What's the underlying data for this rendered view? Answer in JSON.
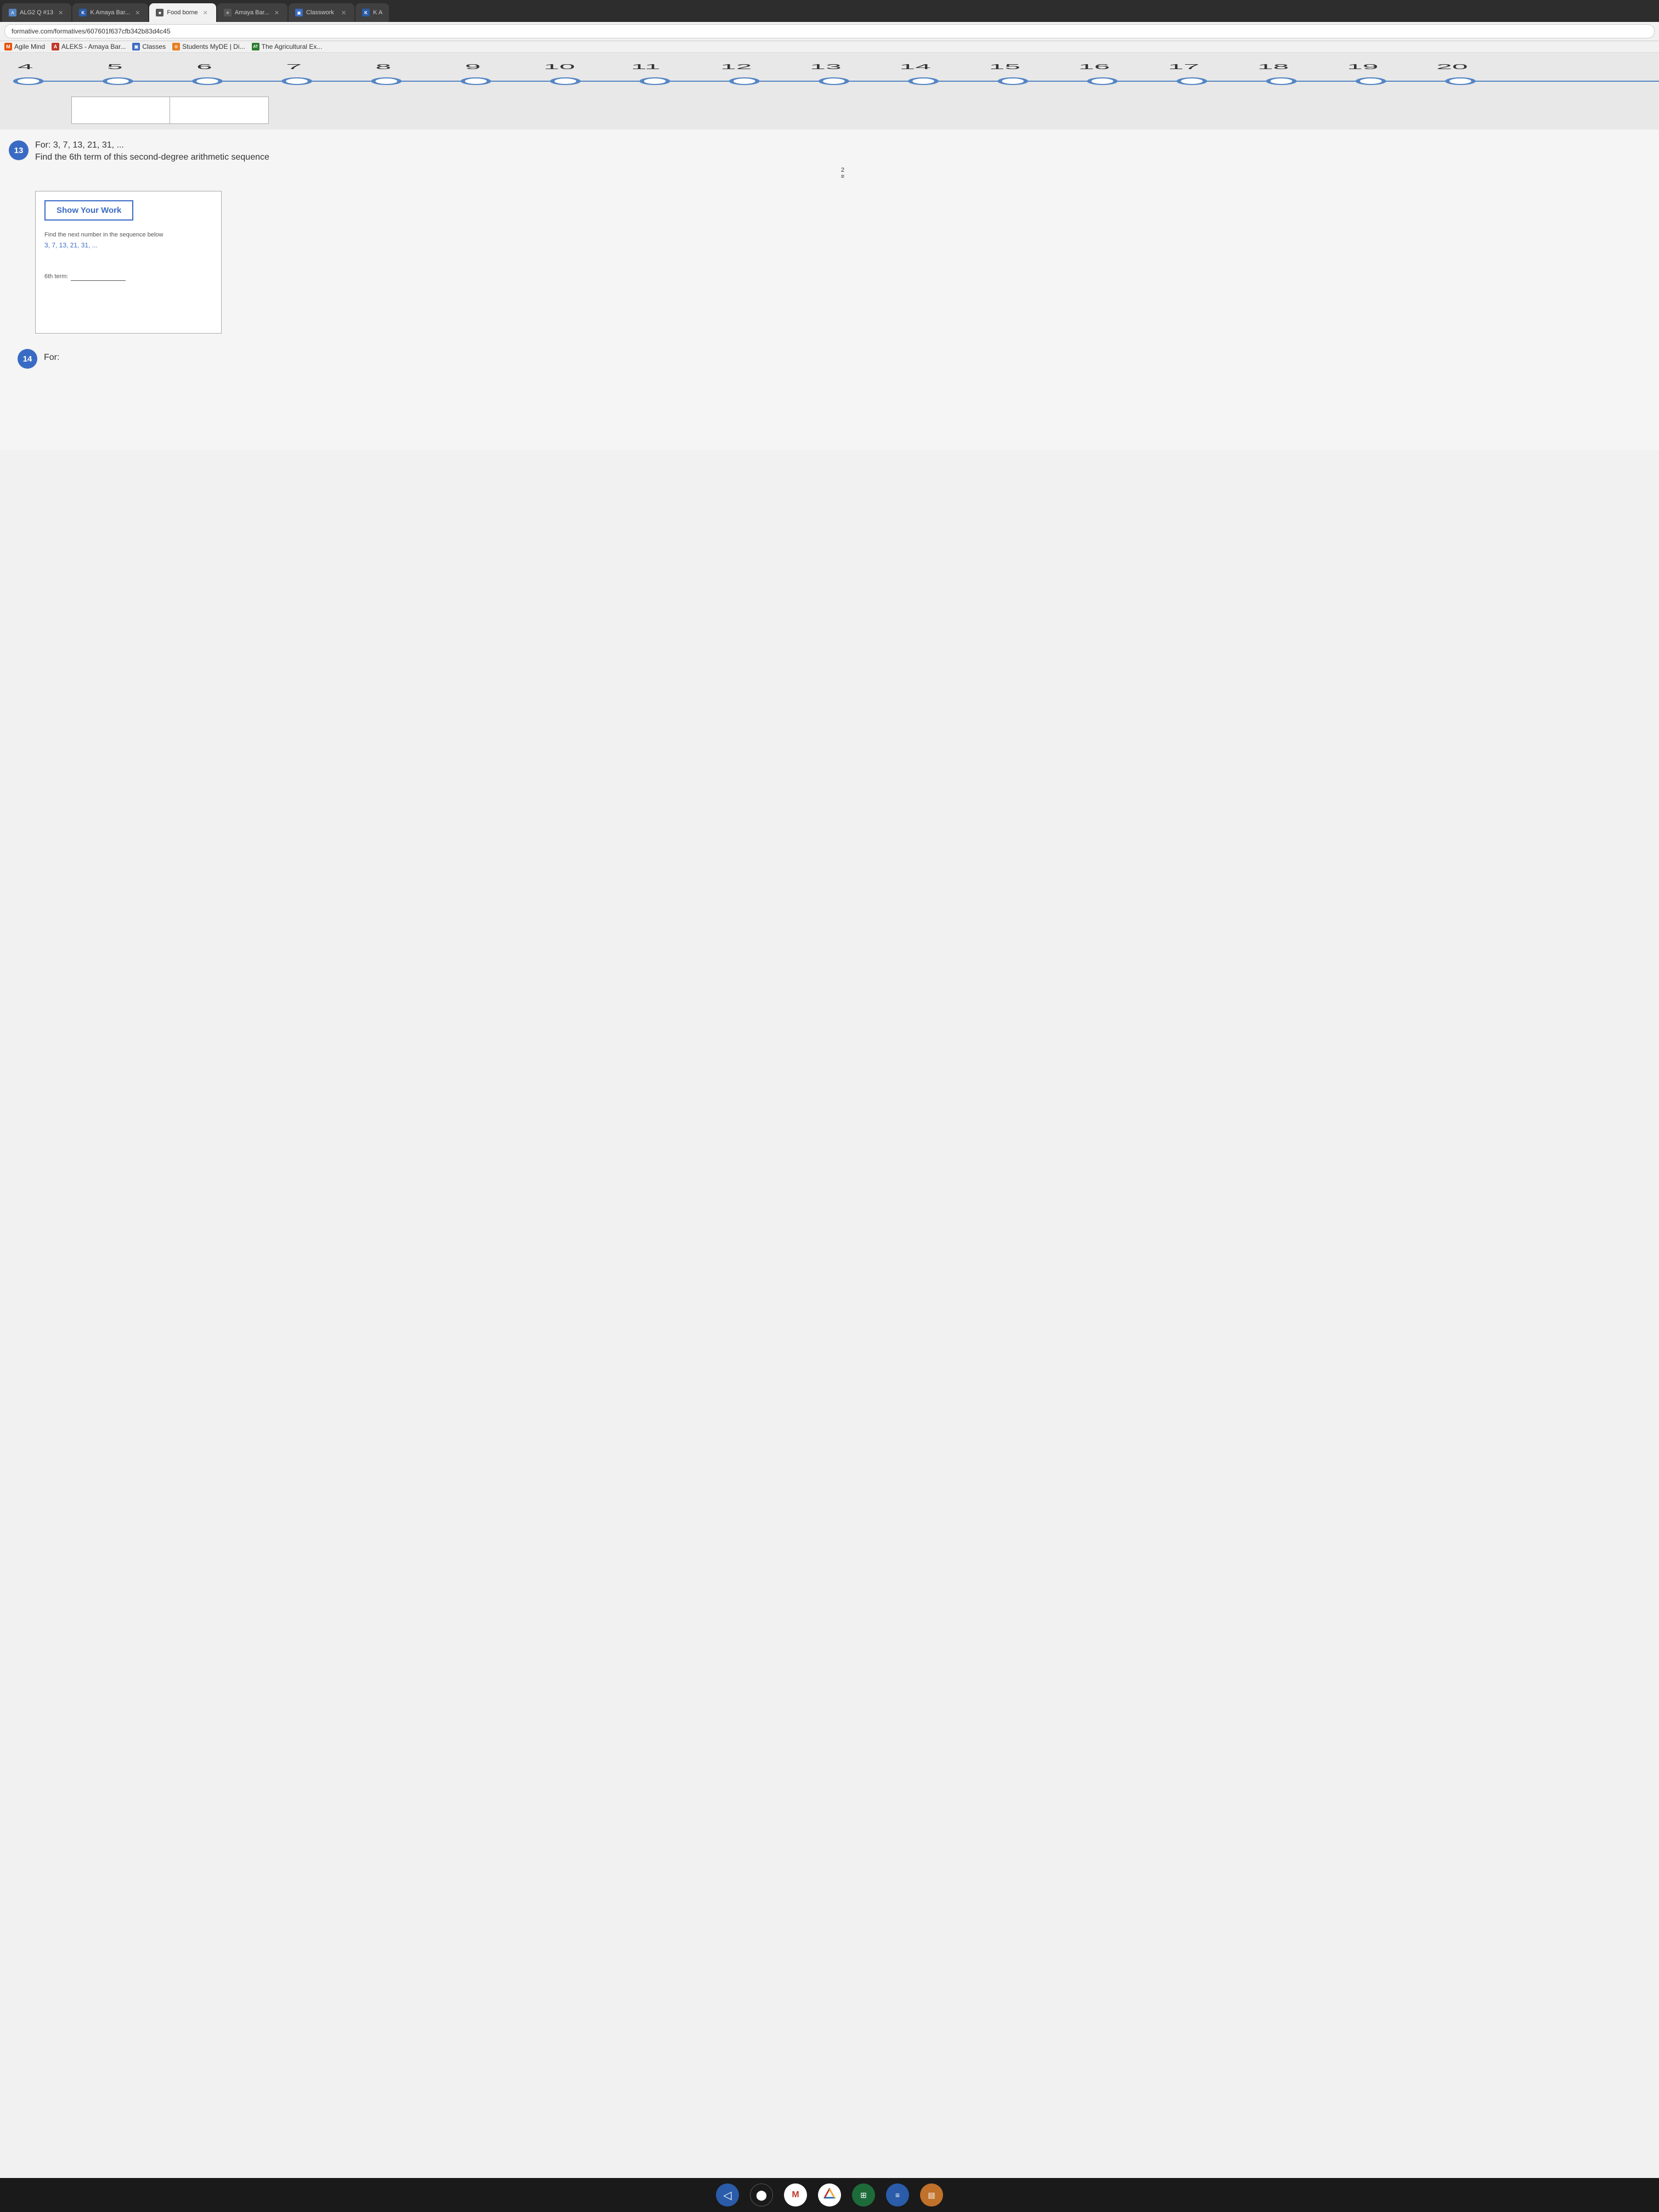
{
  "browser": {
    "tabs": [
      {
        "id": "tab1",
        "label": "ALG2 Q #13",
        "active": false,
        "icon_color": "#5585c5",
        "icon_text": "A"
      },
      {
        "id": "tab2",
        "label": "K  Amaya Bar...",
        "active": false,
        "icon_color": "#2a5caa",
        "icon_text": "K"
      },
      {
        "id": "tab3",
        "label": "Food borne",
        "active": true,
        "icon_color": "#444",
        "icon_text": "■"
      },
      {
        "id": "tab4",
        "label": "Amaya Bar...",
        "active": false,
        "icon_color": "#444",
        "icon_text": "≡"
      },
      {
        "id": "tab5",
        "label": "Classwork",
        "active": false,
        "icon_color": "#3a6bc4",
        "icon_text": "▣"
      },
      {
        "id": "tab6",
        "label": "K  A",
        "active": false,
        "icon_color": "#2a5caa",
        "icon_text": "K"
      }
    ],
    "url": "formative.com/formatives/607601f637cfb342b83d4c45",
    "bookmarks": [
      {
        "label": "Agile Mind",
        "icon": "M"
      },
      {
        "label": "ALEKS - Amaya Bar...",
        "icon": "A"
      },
      {
        "label": "Classes",
        "icon": "▣"
      },
      {
        "label": "Students MyDE | Di...",
        "icon": "⚙"
      },
      {
        "label": "The Agricultural Ex...",
        "icon": "AT"
      }
    ]
  },
  "number_line": {
    "numbers": [
      "4",
      "5",
      "6",
      "7",
      "8",
      "9",
      "10",
      "11",
      "12",
      "13",
      "14",
      "15",
      "16",
      "17",
      "18",
      "19",
      "20"
    ],
    "start": 4,
    "end": 20
  },
  "question13": {
    "number": "13",
    "title": "For:  3, 7, 13, 21, 31, ...",
    "subtitle": "Find the 6th term of this second-degree arithmetic sequence",
    "side_number": "2",
    "show_work_button": "Show Your Work",
    "work_instruction": "Find the next number in the sequence below",
    "work_sequence": "3, 7, 13, 21, 31, ...",
    "term_label": "6th term:"
  },
  "question14": {
    "number": "14",
    "title": "For:"
  },
  "taskbar": {
    "icons": [
      {
        "name": "back-button",
        "symbol": "◁",
        "color": "#2a5caa"
      },
      {
        "name": "camera-button",
        "symbol": "▶",
        "color": "#222"
      },
      {
        "name": "gmail-button",
        "symbol": "M",
        "color": "#c0392b",
        "bg": "#fff"
      },
      {
        "name": "drive-button",
        "symbol": "△",
        "color": "#2a8a4a",
        "bg": "#fff"
      },
      {
        "name": "sheets-button",
        "symbol": "⊞",
        "color": "#fff",
        "bg": "#1e6b3a"
      },
      {
        "name": "docs-button",
        "symbol": "≡",
        "color": "#fff",
        "bg": "#2a5caa"
      },
      {
        "name": "slides-button",
        "symbol": "▤",
        "color": "#fff",
        "bg": "#c0712a"
      }
    ]
  }
}
